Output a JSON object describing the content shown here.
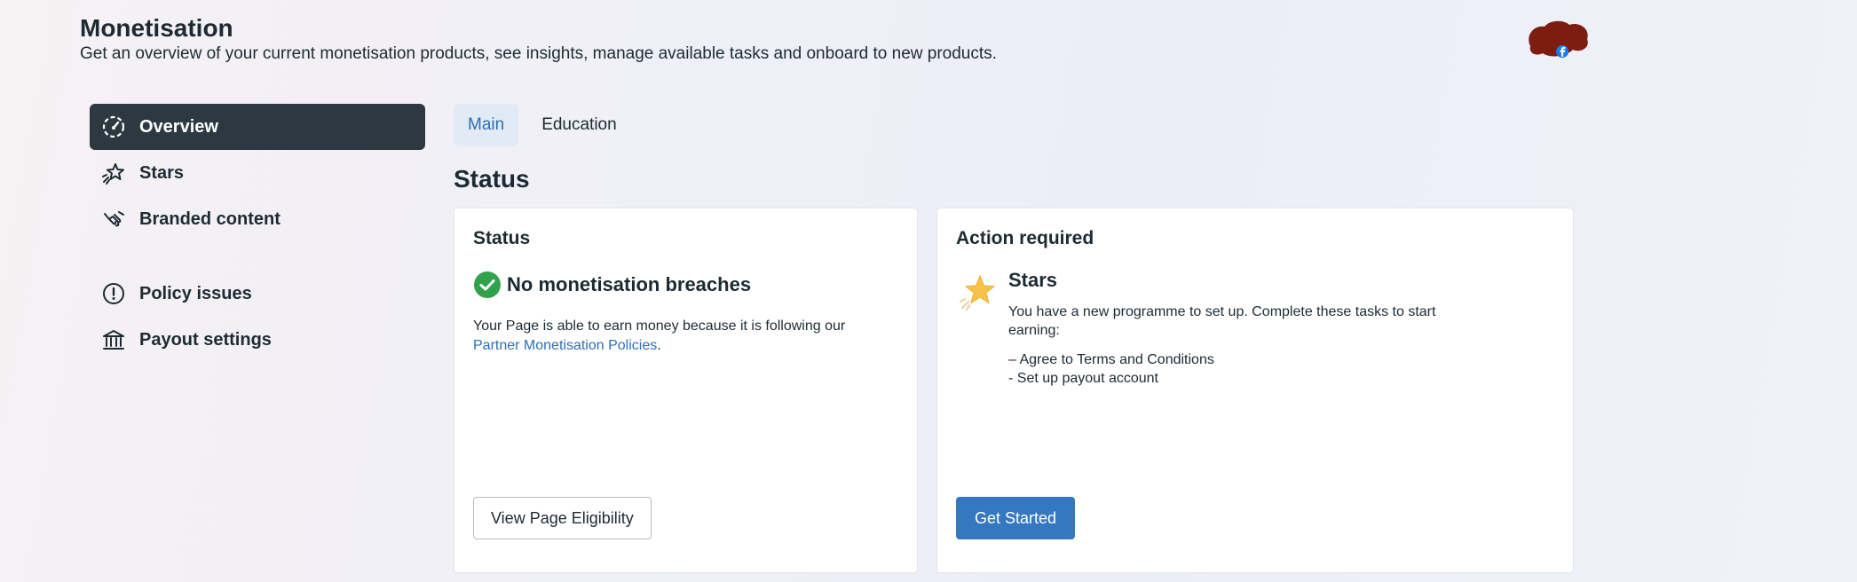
{
  "header": {
    "title": "Monetisation",
    "subtitle": "Get an overview of your current monetisation products, see insights, manage available tasks and onboard to new products."
  },
  "sidebar": {
    "items": [
      {
        "label": "Overview",
        "icon": "gauge-icon",
        "active": true
      },
      {
        "label": "Stars",
        "icon": "stars-icon"
      },
      {
        "label": "Branded content",
        "icon": "handshake-icon"
      },
      {
        "label": "Policy issues",
        "icon": "alert-circle-icon"
      },
      {
        "label": "Payout settings",
        "icon": "bank-icon"
      }
    ]
  },
  "tabs": [
    {
      "label": "Main",
      "active": true
    },
    {
      "label": "Education"
    }
  ],
  "section": {
    "title": "Status"
  },
  "status_card": {
    "title": "Status",
    "heading": "No monetisation breaches",
    "text": "Your Page is able to earn money because it is following our",
    "link": "Partner Monetisation Policies",
    "after_link": ".",
    "button": "View Page Eligibility"
  },
  "action_card": {
    "title": "Action required",
    "task_title": "Stars",
    "task_desc": "You have a new programme to set up. Complete these tasks to start earning:",
    "tasks": [
      "– Agree to Terms and Conditions",
      "- Set up payout account"
    ],
    "button": "Get Started"
  },
  "colors": {
    "accent": "#3578c0",
    "active_nav": "#2d3940",
    "success": "#31a24c",
    "link": "#2d6fb6"
  }
}
